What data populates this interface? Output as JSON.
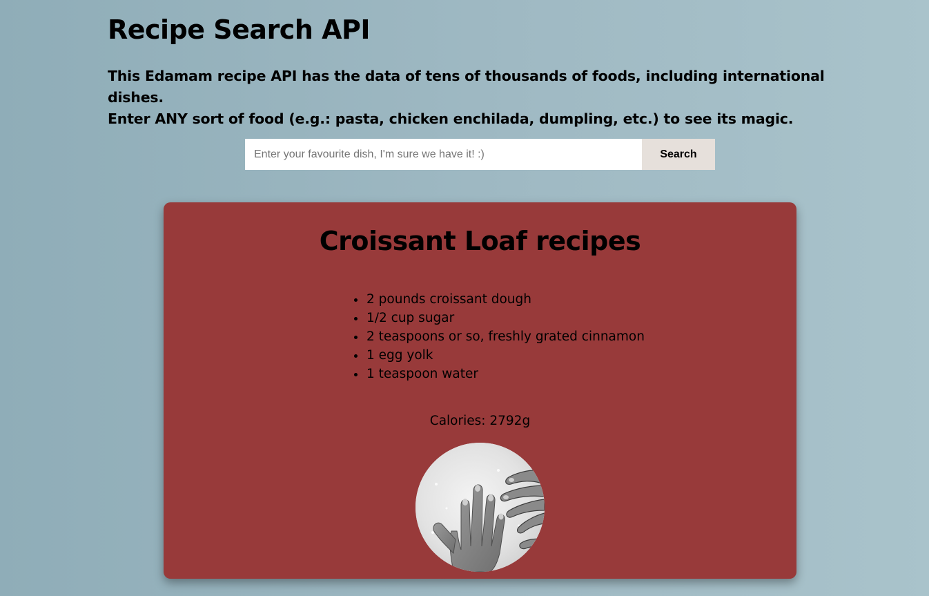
{
  "header": {
    "title": "Recipe Search API",
    "intro_line1": "This Edamam recipe API has the data of tens of thousands of foods, including international dishes.",
    "intro_line2": "Enter ANY sort of food (e.g.: pasta, chicken enchilada, dumpling, etc.) to see its magic."
  },
  "search": {
    "placeholder": "Enter your favourite dish, I'm sure we have it! :)",
    "value": "",
    "button_label": "Search"
  },
  "recipe": {
    "title": "Croissant Loaf recipes",
    "ingredients": [
      "2 pounds croissant dough",
      "1/2 cup sugar",
      "2 teaspoons or so, freshly grated cinnamon",
      "1 egg yolk",
      "1 teaspoon water"
    ],
    "calories_text": "Calories: 2792g",
    "image_icon": "hands-dough-photo"
  },
  "colors": {
    "card": "#983a3a",
    "button": "#e6e0db",
    "background_left": "#8fadb8",
    "background_right": "#a9c3cb"
  }
}
